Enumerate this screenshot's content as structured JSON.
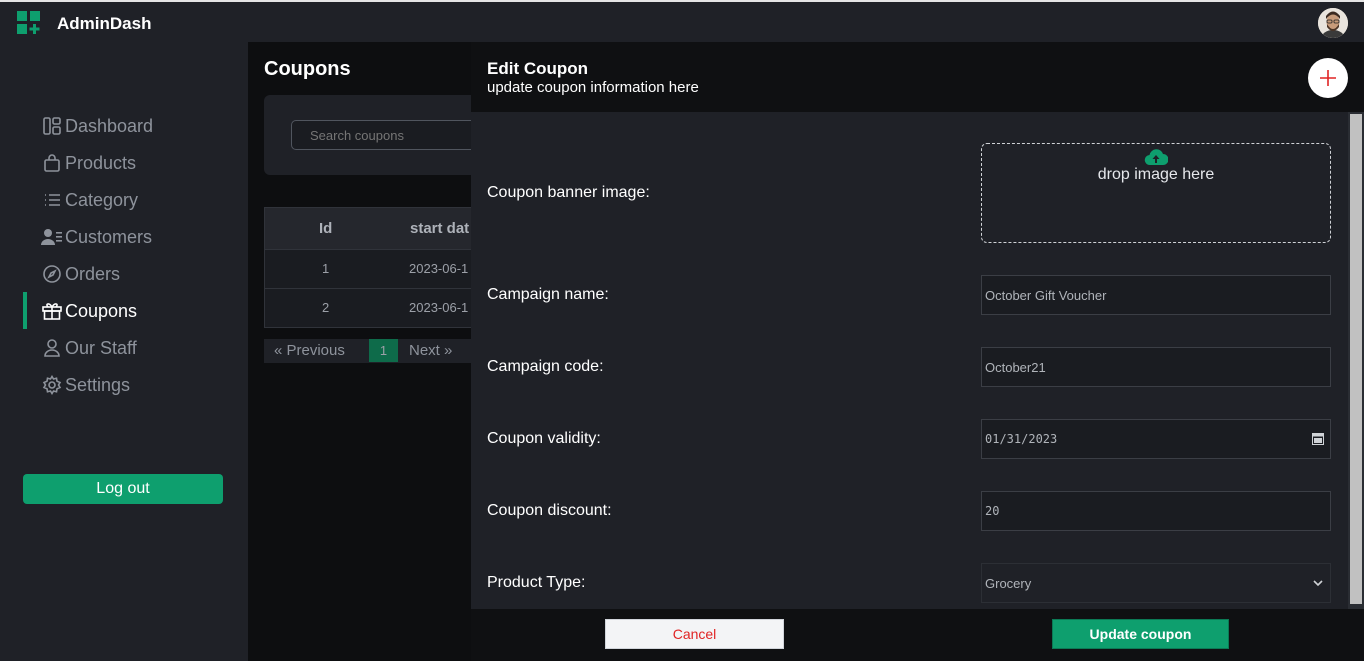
{
  "app": {
    "brand": "AdminDash",
    "accent": "#0e9f6e"
  },
  "sidebar": {
    "items": [
      {
        "label": "Dashboard",
        "icon": "grid-icon",
        "active": false
      },
      {
        "label": "Products",
        "icon": "shopping-bag-icon",
        "active": false
      },
      {
        "label": "Category",
        "icon": "list-icon",
        "active": false
      },
      {
        "label": "Customers",
        "icon": "users-icon",
        "active": false
      },
      {
        "label": "Orders",
        "icon": "compass-icon",
        "active": false
      },
      {
        "label": "Coupons",
        "icon": "gift-icon",
        "active": true
      },
      {
        "label": "Our Staff",
        "icon": "user-icon",
        "active": false
      },
      {
        "label": "Settings",
        "icon": "gear-icon",
        "active": false
      }
    ],
    "logout_label": "Log out"
  },
  "page": {
    "title": "Coupons",
    "search_placeholder": "Search coupons",
    "table": {
      "headers": [
        "Id",
        "start dat"
      ],
      "rows": [
        [
          "1",
          "2023-06-1"
        ],
        [
          "2",
          "2023-06-1"
        ]
      ]
    },
    "pagination": {
      "prev": "«   Previous",
      "current": "1",
      "next": "Next   »"
    }
  },
  "drawer": {
    "title": "Edit Coupon",
    "subtitle": "update coupon information here",
    "fields": {
      "banner_label": "Coupon banner image:",
      "drop_text": "drop image here",
      "campaign_name_label": "Campaign name:",
      "campaign_name_value": "October Gift Voucher",
      "campaign_code_label": "Campaign code:",
      "campaign_code_value": "October21",
      "validity_label": "Coupon validity:",
      "validity_value": "01/31/2023",
      "discount_label": "Coupon discount:",
      "discount_value": "20",
      "product_type_label": "Product Type:",
      "product_type_value": "Grocery"
    },
    "cancel_label": "Cancel",
    "update_label": "Update coupon"
  }
}
